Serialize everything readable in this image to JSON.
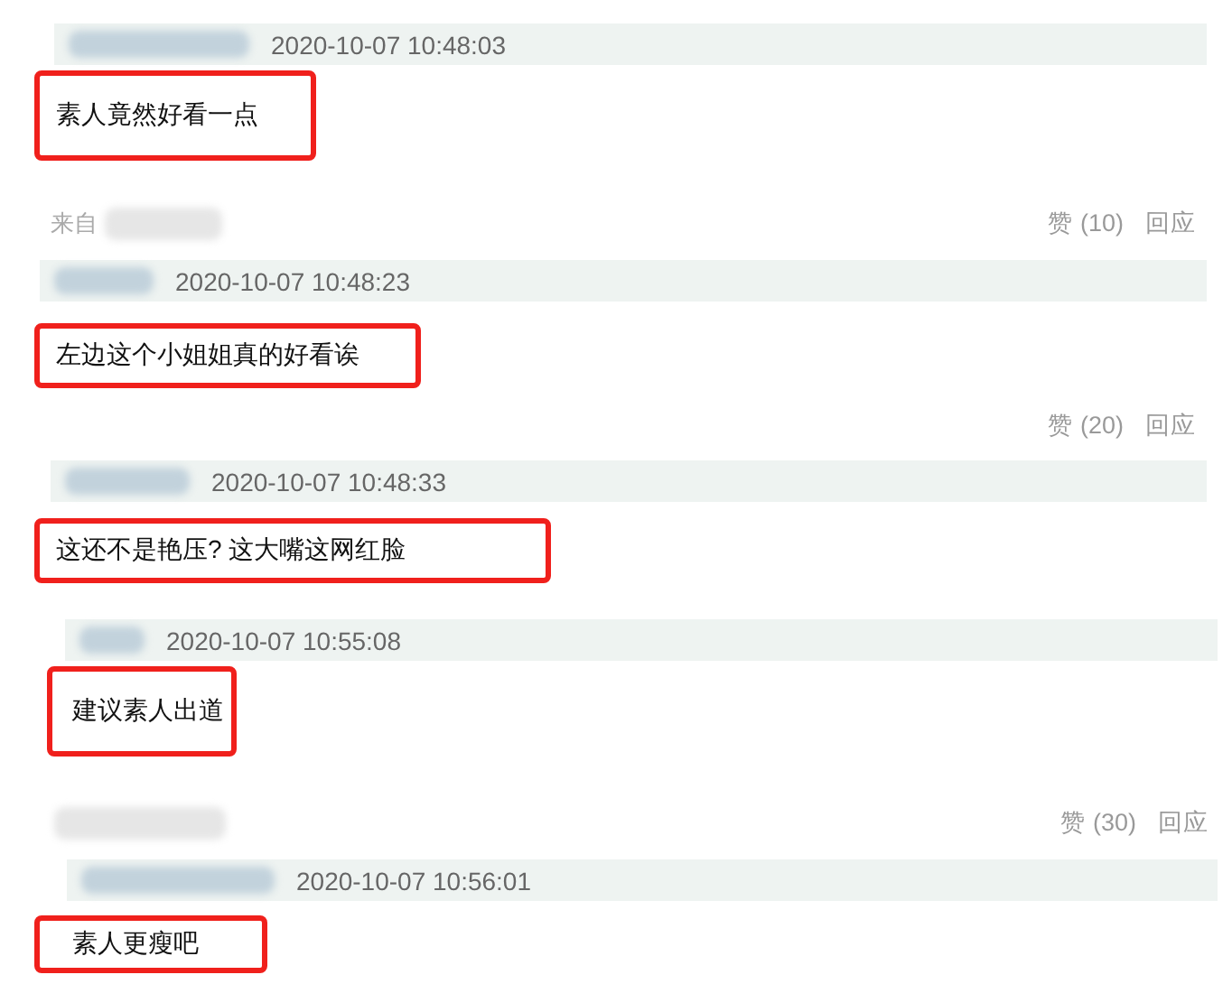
{
  "items": [
    {
      "kind": "comment",
      "time": "2020-10-07 10:48:03",
      "text": "素人竟然好看一点"
    },
    {
      "kind": "actions",
      "source_label": "来自",
      "likes": "赞 (10)",
      "reply": "回应"
    },
    {
      "kind": "comment",
      "time": "2020-10-07 10:48:23",
      "text": "左边这个小姐姐真的好看诶"
    },
    {
      "kind": "actions",
      "likes": "赞 (20)",
      "reply": "回应"
    },
    {
      "kind": "comment",
      "time": "2020-10-07 10:48:33",
      "text": "这还不是艳压? 这大嘴这网红脸"
    },
    {
      "kind": "comment",
      "time": "2020-10-07 10:55:08",
      "text": "建议素人出道"
    },
    {
      "kind": "actions",
      "likes": "赞 (30)",
      "reply": "回应"
    },
    {
      "kind": "comment",
      "time": "2020-10-07 10:56:01",
      "text": "素人更瘦吧"
    }
  ]
}
